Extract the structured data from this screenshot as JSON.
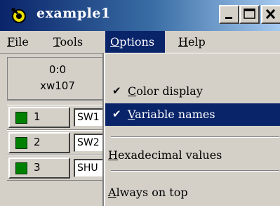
{
  "window": {
    "title": "example1"
  },
  "menubar": {
    "file": {
      "label_first": "F",
      "label_rest": "ile"
    },
    "tools": {
      "label_first": "T",
      "label_rest": "ools"
    },
    "options": {
      "label_first": "O",
      "label_rest": "ptions"
    },
    "help": {
      "label_first": "H",
      "label_rest": "elp"
    }
  },
  "panel": {
    "header_line1": "0:0",
    "header_line2": "xw107"
  },
  "rows": [
    {
      "number": "1",
      "field": "SW1"
    },
    {
      "number": "2",
      "field": "SW2"
    },
    {
      "number": "3",
      "field": "SHU"
    }
  ],
  "options_menu": {
    "color_display": {
      "check": "✔",
      "label_first": "C",
      "label_rest": "olor display",
      "checked": true
    },
    "variable_names": {
      "check": "✔",
      "label_first": "V",
      "label_rest": "ariable names",
      "checked": true
    },
    "hex_values": {
      "label_first": "H",
      "label_rest": "exadecimal values",
      "checked": false
    },
    "always_on_top": {
      "label_first": "A",
      "label_rest": "lways on top",
      "checked": false
    }
  },
  "colors": {
    "title_bar": "#0a246a",
    "selection": "#0a246a",
    "led_on": "#008000",
    "face": "#d4d0c8"
  }
}
